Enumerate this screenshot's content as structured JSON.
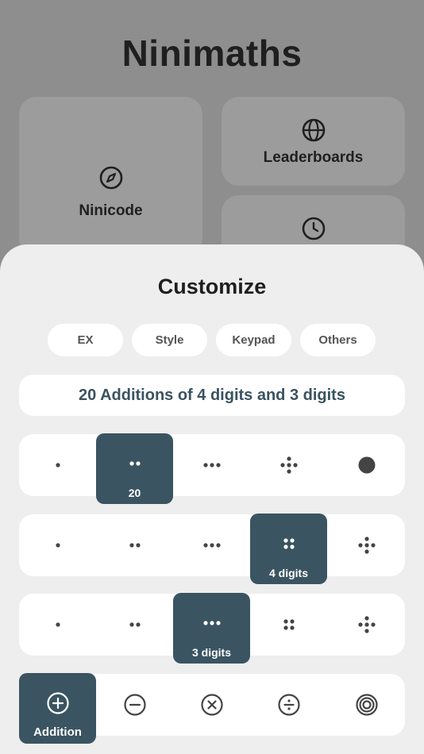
{
  "app": {
    "title": "Ninimaths"
  },
  "background_cards": {
    "ninicode": {
      "label": "Ninicode",
      "icon": "compass-icon"
    },
    "leaderboards": {
      "label": "Leaderboards",
      "icon": "globe-icon"
    },
    "history": {
      "icon": "clock-icon"
    }
  },
  "sheet": {
    "title": "Customize",
    "tabs": [
      {
        "label": "EX"
      },
      {
        "label": "Style"
      },
      {
        "label": "Keypad"
      },
      {
        "label": "Others"
      }
    ],
    "summary": "20 Additions of 4 digits and 3 digits",
    "count_row": {
      "selected_label": "20",
      "options": [
        "one-dot-icon",
        "two-dots-icon",
        "three-dots-icon",
        "five-dots-icon",
        "filled-circle-icon"
      ]
    },
    "first_digits_row": {
      "selected_label": "4 digits",
      "options": [
        "one-dot-icon",
        "two-dots-icon",
        "three-dots-icon",
        "four-dots-icon",
        "five-dots-icon"
      ]
    },
    "second_digits_row": {
      "selected_label": "3 digits",
      "options": [
        "one-dot-icon",
        "two-dots-icon",
        "three-dots-icon",
        "four-dots-icon",
        "five-dots-icon"
      ]
    },
    "operation_row": {
      "selected_label": "Addition",
      "options": [
        "plus-circle-icon",
        "minus-circle-icon",
        "times-circle-icon",
        "divide-circle-icon",
        "target-icon"
      ]
    }
  },
  "colors": {
    "selected": "#3a5462",
    "summary_text": "#3a5260",
    "sheet_bg": "#eeeeee"
  }
}
